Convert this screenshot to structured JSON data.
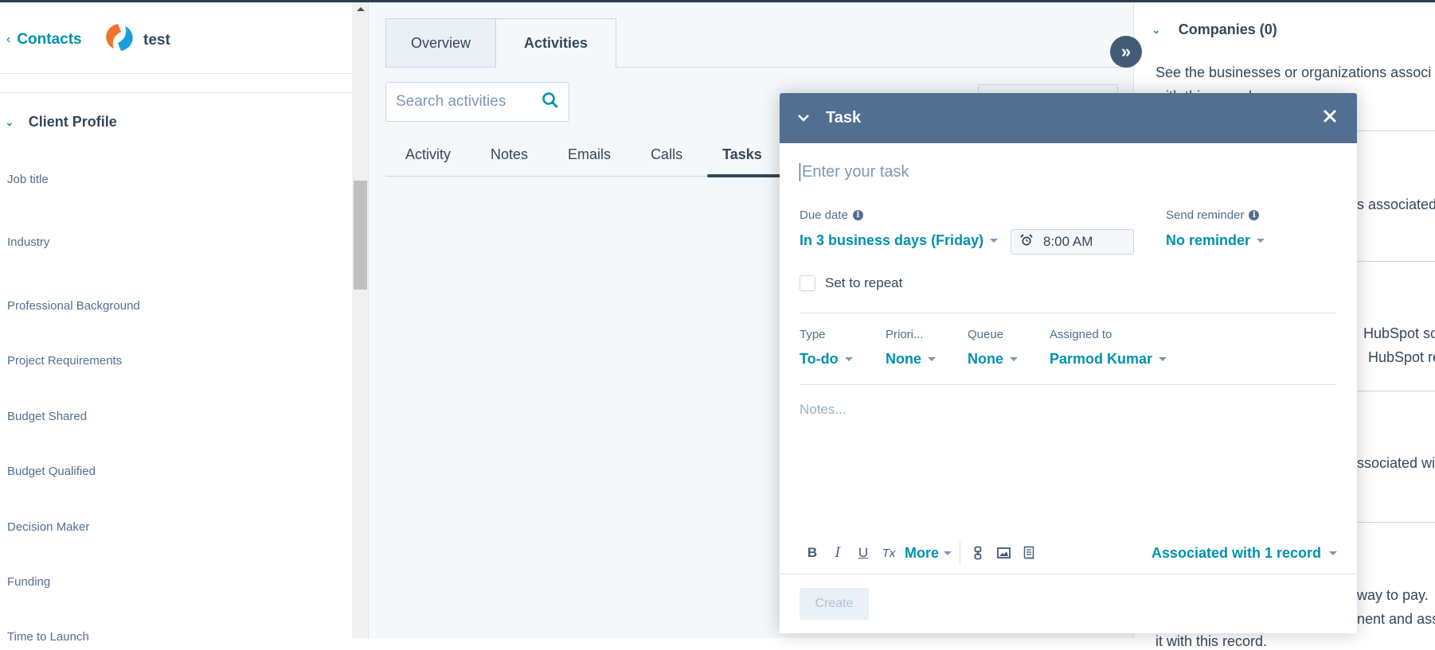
{
  "header": {
    "back_label": "Contacts",
    "record_name": "test"
  },
  "left_panel": {
    "section_title": "Client Profile",
    "properties": [
      "Job title",
      "Industry",
      "Professional Background",
      "Project Requirements",
      "Budget Shared",
      "Budget Qualified",
      "Decision Maker",
      "Funding",
      "Time to Launch"
    ]
  },
  "main": {
    "tabs": [
      {
        "label": "Overview",
        "active": false
      },
      {
        "label": "Activities",
        "active": true
      }
    ],
    "search": {
      "placeholder": "Search activities",
      "value": ""
    },
    "activity_tabs": [
      {
        "label": "Activity",
        "active": false
      },
      {
        "label": "Notes",
        "active": false
      },
      {
        "label": "Emails",
        "active": false
      },
      {
        "label": "Calls",
        "active": false
      },
      {
        "label": "Tasks",
        "active": true
      }
    ]
  },
  "right_sidebar": {
    "companies_title": "Companies (0)",
    "companies_desc_line1": "See the businesses or organizations associ",
    "companies_desc_line2": "with this record.",
    "snippet_2": "s associated",
    "snippet_3a": "HubSpot so",
    "snippet_3b": "HubSpot re",
    "snippet_4": "ssociated wi",
    "snippet_5a": "way to pay.",
    "snippet_5b": "nent and ass",
    "snippet_5c": "it with this record."
  },
  "task_modal": {
    "title": "Task",
    "task_placeholder": "Enter your task",
    "due_date_label": "Due date",
    "due_date_value": "In 3 business days (Friday)",
    "time_value": "8:00 AM",
    "reminder_label": "Send reminder",
    "reminder_value": "No reminder",
    "repeat_label": "Set to repeat",
    "repeat_checked": false,
    "type_label": "Type",
    "type_value": "To-do",
    "priority_label": "Priori...",
    "priority_value": "None",
    "queue_label": "Queue",
    "queue_value": "None",
    "assigned_label": "Assigned to",
    "assigned_value": "Parmod Kumar",
    "notes_placeholder": "Notes...",
    "toolbar": {
      "bold": "B",
      "italic": "I",
      "underline": "U",
      "clear_format": "Tx",
      "more": "More"
    },
    "associated": "Associated with 1 record",
    "create_label": "Create"
  },
  "colors": {
    "accent": "#0091ae",
    "modal_header": "#516f90",
    "text_primary": "#33475b",
    "text_secondary": "#516f90",
    "topbar": "#2d3e50"
  }
}
